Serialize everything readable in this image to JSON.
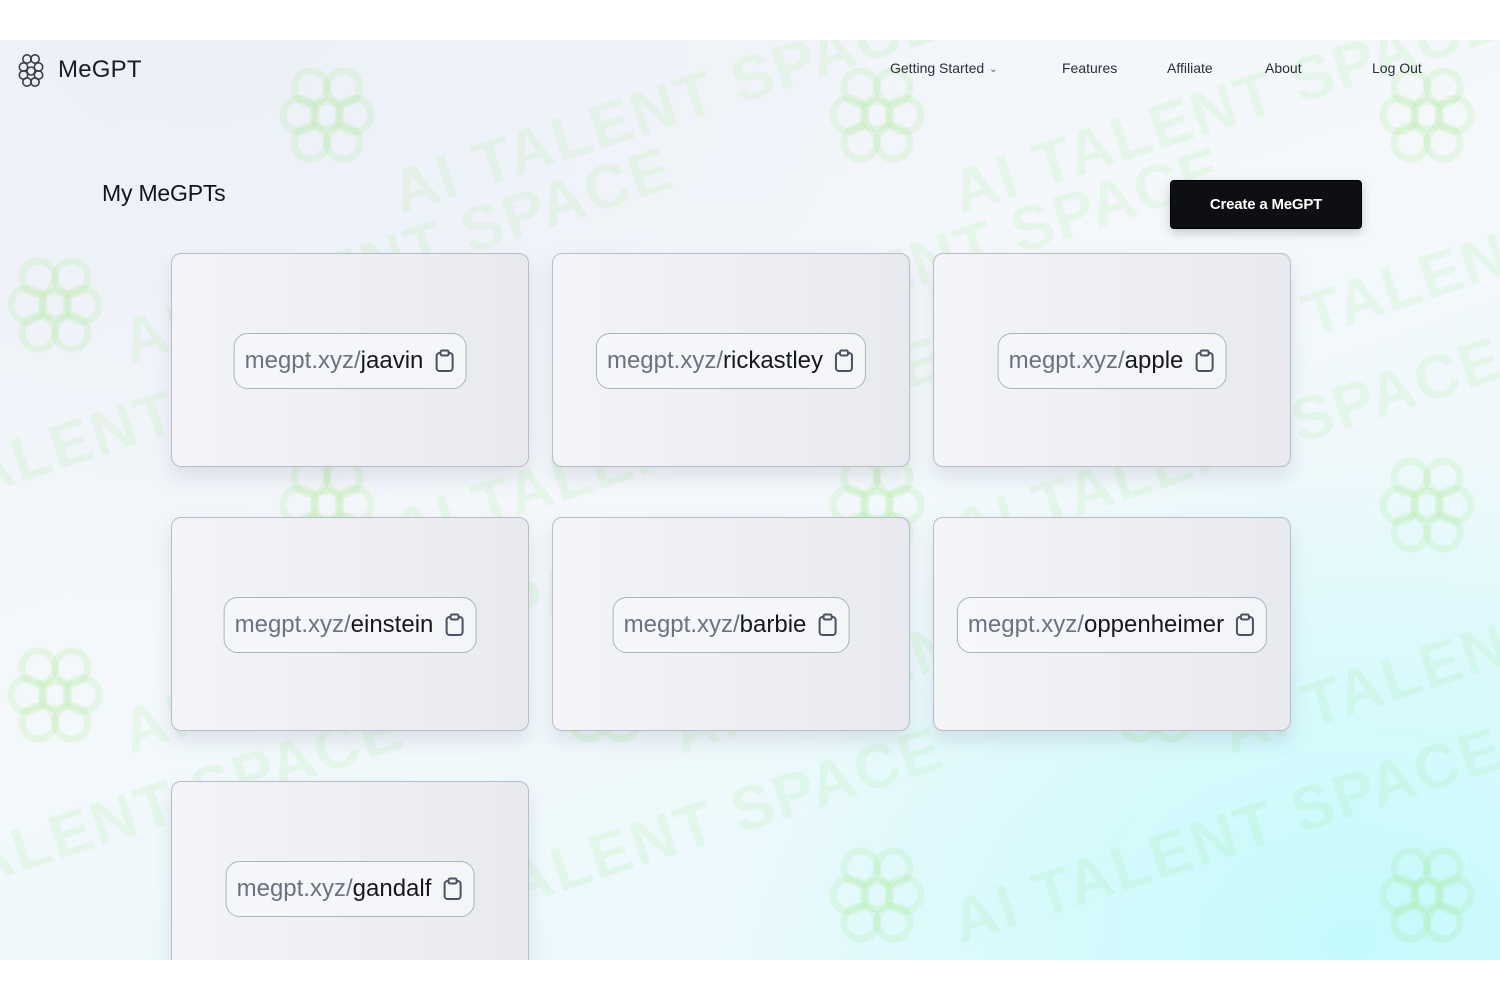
{
  "app": {
    "brand_name": "MeGPT",
    "logo_icon": "knot-logo-icon"
  },
  "nav": {
    "getting_started": "Getting Started",
    "getting_started_chevron": "⌄",
    "features": "Features",
    "affiliate": "Affiliate",
    "about": "About",
    "log_out": "Log Out"
  },
  "main": {
    "title": "My MeGPTs",
    "create_button": "Create a MeGPT",
    "cards": [
      {
        "prefix": "megpt.xyz/",
        "slug": "jaavin"
      },
      {
        "prefix": "megpt.xyz/",
        "slug": "rickastley"
      },
      {
        "prefix": "megpt.xyz/",
        "slug": "apple"
      },
      {
        "prefix": "megpt.xyz/",
        "slug": "einstein"
      },
      {
        "prefix": "megpt.xyz/",
        "slug": "barbie"
      },
      {
        "prefix": "megpt.xyz/",
        "slug": "oppenheimer"
      },
      {
        "prefix": "megpt.xyz/",
        "slug": "gandalf"
      }
    ],
    "copy_icon": "clipboard-icon"
  },
  "watermark": {
    "text": "AI TALENT SPACE",
    "icon": "knot-logo-icon",
    "color": "#96e678"
  }
}
